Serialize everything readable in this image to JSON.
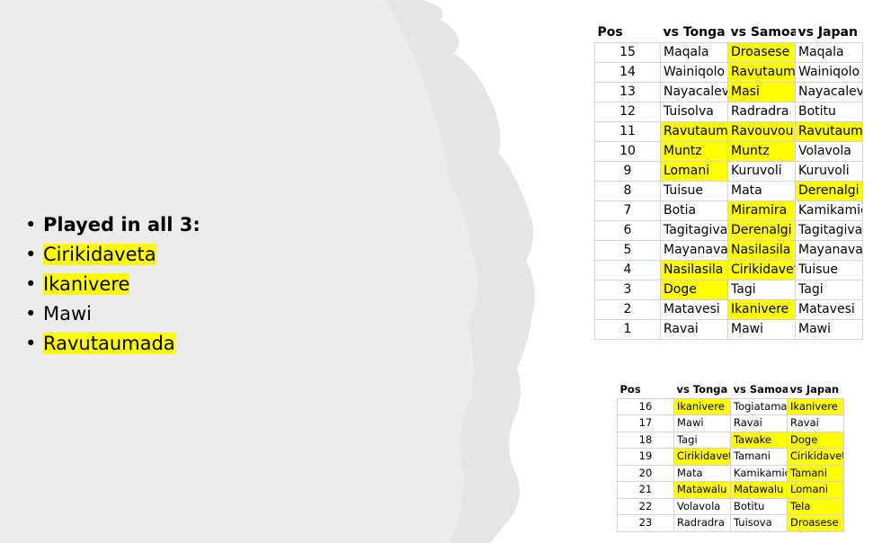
{
  "bullets": [
    {
      "text": "Played in all 3:",
      "bold": true,
      "highlight": false
    },
    {
      "text": "Cirikidaveta",
      "bold": false,
      "highlight": true
    },
    {
      "text": "Ikanivere",
      "bold": false,
      "highlight": true
    },
    {
      "text": "Mawi",
      "bold": false,
      "highlight": false
    },
    {
      "text": "Ravutaumada",
      "bold": false,
      "highlight": true
    }
  ],
  "bullet_char": "•",
  "highlight_color": "#ffff00",
  "table_top": {
    "headers": [
      "Pos",
      "vs Tonga",
      "vs Samoa",
      "vs Japan"
    ],
    "rows": [
      {
        "pos": "15",
        "cells": [
          [
            "Maqala",
            false
          ],
          [
            "Droasese",
            true
          ],
          [
            "Maqala",
            false
          ]
        ]
      },
      {
        "pos": "14",
        "cells": [
          [
            "Wainiqolo",
            false
          ],
          [
            "Ravutaumada",
            true
          ],
          [
            "Wainiqolo",
            false
          ]
        ]
      },
      {
        "pos": "13",
        "cells": [
          [
            "Nayacalevu",
            false
          ],
          [
            "Masi",
            true
          ],
          [
            "Nayacalevu",
            false
          ]
        ]
      },
      {
        "pos": "12",
        "cells": [
          [
            "Tuisolva",
            false
          ],
          [
            "Radradra",
            false
          ],
          [
            "Botitu",
            false
          ]
        ]
      },
      {
        "pos": "11",
        "cells": [
          [
            "Ravutaumada",
            true
          ],
          [
            "Ravouvou",
            true
          ],
          [
            "Ravutaumada",
            true
          ]
        ]
      },
      {
        "pos": "10",
        "cells": [
          [
            "Muntz",
            true
          ],
          [
            "Muntz",
            true
          ],
          [
            "Volavola",
            false
          ]
        ]
      },
      {
        "pos": "9",
        "cells": [
          [
            "Lomani",
            true
          ],
          [
            "Kuruvoli",
            false
          ],
          [
            "Kuruvoli",
            false
          ]
        ]
      },
      {
        "pos": "8",
        "cells": [
          [
            "Tuisue",
            false
          ],
          [
            "Mata",
            false
          ],
          [
            "Derenalgi",
            true
          ]
        ]
      },
      {
        "pos": "7",
        "cells": [
          [
            "Botia",
            false
          ],
          [
            "Miramira",
            true
          ],
          [
            "Kamikamica",
            false
          ]
        ]
      },
      {
        "pos": "6",
        "cells": [
          [
            "Tagitagivalu",
            false
          ],
          [
            "Derenalgi",
            true
          ],
          [
            "Tagitagivalu",
            false
          ]
        ]
      },
      {
        "pos": "5",
        "cells": [
          [
            "Mayanavanua",
            false
          ],
          [
            "Nasilasila",
            true
          ],
          [
            "Mayanavanua",
            false
          ]
        ]
      },
      {
        "pos": "4",
        "cells": [
          [
            "Nasilasila",
            true
          ],
          [
            "Cirikidaveta",
            true
          ],
          [
            "Tuisue",
            false
          ]
        ]
      },
      {
        "pos": "3",
        "cells": [
          [
            "Doge",
            true
          ],
          [
            "Tagi",
            false
          ],
          [
            "Tagi",
            false
          ]
        ]
      },
      {
        "pos": "2",
        "cells": [
          [
            "Matavesi",
            false
          ],
          [
            "Ikanivere",
            true
          ],
          [
            "Matavesi",
            false
          ]
        ]
      },
      {
        "pos": "1",
        "cells": [
          [
            "Ravai",
            false
          ],
          [
            "Mawi",
            false
          ],
          [
            "Mawi",
            false
          ]
        ]
      }
    ]
  },
  "table_bottom": {
    "headers": [
      "Pos",
      "vs Tonga",
      "vs Samoa",
      "vs Japan"
    ],
    "rows": [
      {
        "pos": "16",
        "cells": [
          [
            "Ikanivere",
            true
          ],
          [
            "Togiatama",
            false
          ],
          [
            "Ikanivere",
            true
          ]
        ]
      },
      {
        "pos": "17",
        "cells": [
          [
            "Mawi",
            false
          ],
          [
            "Ravai",
            false
          ],
          [
            "Ravai",
            false
          ]
        ]
      },
      {
        "pos": "18",
        "cells": [
          [
            "Tagi",
            false
          ],
          [
            "Tawake",
            true
          ],
          [
            "Doge",
            true
          ]
        ]
      },
      {
        "pos": "19",
        "cells": [
          [
            "Cirikidaveta",
            true
          ],
          [
            "Tamani",
            false
          ],
          [
            "Cirikidaveta",
            true
          ]
        ]
      },
      {
        "pos": "20",
        "cells": [
          [
            "Mata",
            false
          ],
          [
            "Kamikamica",
            false
          ],
          [
            "Tamani",
            true
          ]
        ]
      },
      {
        "pos": "21",
        "cells": [
          [
            "Matawalu",
            true
          ],
          [
            "Matawalu",
            true
          ],
          [
            "Lomani",
            true
          ]
        ]
      },
      {
        "pos": "22",
        "cells": [
          [
            "Volavola",
            false
          ],
          [
            "Botitu",
            false
          ],
          [
            "Tela",
            true
          ]
        ]
      },
      {
        "pos": "23",
        "cells": [
          [
            "Radradra",
            false
          ],
          [
            "Tuisova",
            false
          ],
          [
            "Droasese",
            true
          ]
        ]
      }
    ]
  }
}
